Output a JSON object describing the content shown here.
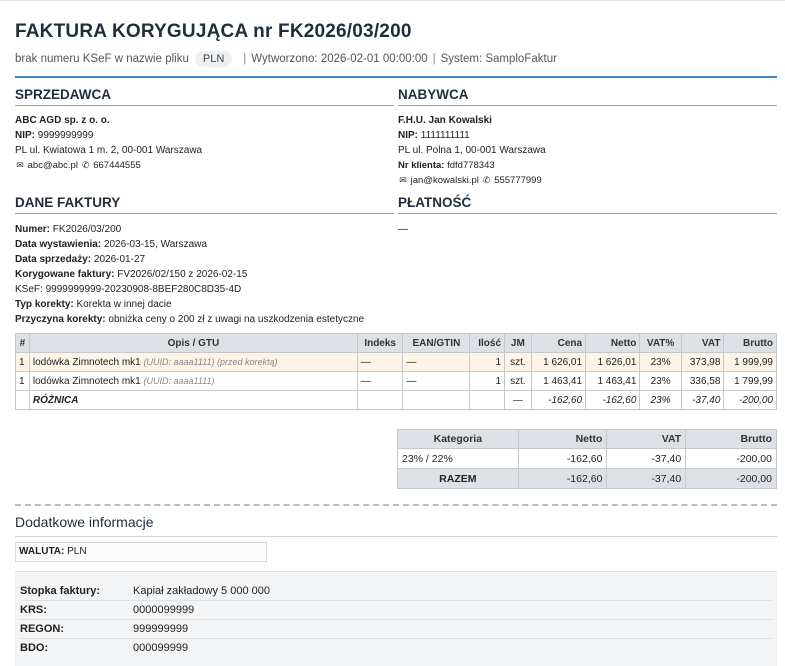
{
  "header": {
    "title": "FAKTURA KORYGUJĄCA nr FK2026/03/200",
    "ksef_note": "brak numeru KSeF w nazwie pliku",
    "currency_pill": "PLN",
    "created": "Wytworzono: 2026-02-01 00:00:00",
    "system": "System: SamploFaktur",
    "separator": "|"
  },
  "seller": {
    "heading": "SPRZEDAWCA",
    "name": "ABC AGD sp. z o. o.",
    "nip_label": "NIP:",
    "nip": "9999999999",
    "address": "PL ul. Kwiatowa 1 m. 2, 00-001 Warszawa",
    "email": "abc@abc.pl",
    "phone": "667444555"
  },
  "buyer": {
    "heading": "NABYWCA",
    "name": "F.H.U. Jan Kowalski",
    "nip_label": "NIP:",
    "nip": "1111111111",
    "address": "PL ul. Polna 1, 00-001 Warszawa",
    "client_label": "Nr klienta:",
    "client_no": "fdfd778343",
    "email": "jan@kowalski.pl",
    "phone": "555777999"
  },
  "invoice": {
    "heading": "DANE FAKTURY",
    "number_label": "Numer:",
    "number": "FK2026/03/200",
    "issue_label": "Data wystawienia:",
    "issue": "2026-03-15, Warszawa",
    "sale_label": "Data sprzedaży:",
    "sale": "2026-01-27",
    "corrected_label": "Korygowane faktury:",
    "corrected": "FV2026/02/150 z 2026-02-15",
    "ksef": "KSeF: 9999999999-20230908-8BEF280C8D35-4D",
    "type_label": "Typ korekty:",
    "type": "Korekta w innej dacie",
    "reason_label": "Przyczyna korekty:",
    "reason": "obniżka ceny o 200 zł z uwagi na uszkodzenia estetyczne"
  },
  "payment": {
    "heading": "PŁATNOŚĆ",
    "value": "—"
  },
  "items": {
    "headers": [
      "#",
      "Opis / GTU",
      "Indeks",
      "EAN/GTIN",
      "Ilość",
      "JM",
      "Cena",
      "Netto",
      "VAT%",
      "VAT",
      "Brutto"
    ],
    "rows": [
      {
        "no": "1",
        "desc": "lodówka Zimnotech mk1",
        "note": "(UUID: aaaa1111) (przed korektą)",
        "index": "—",
        "ean": "—",
        "qty": "1",
        "unit": "szt.",
        "price": "1 626,01",
        "net": "1 626,01",
        "vat_rate": "23%",
        "vat": "373,98",
        "gross": "1 999,99"
      },
      {
        "no": "1",
        "desc": "lodówka Zimnotech mk1",
        "note": "(UUID: aaaa1111)",
        "index": "—",
        "ean": "—",
        "qty": "1",
        "unit": "szt.",
        "price": "1 463,41",
        "net": "1 463,41",
        "vat_rate": "23%",
        "vat": "336,58",
        "gross": "1 799,99"
      }
    ],
    "diff": {
      "label": "RÓŻNICA",
      "unit": "—",
      "price": "-162,60",
      "net": "-162,60",
      "vat_rate": "23%",
      "vat": "-37,40",
      "gross": "-200,00"
    }
  },
  "summary": {
    "headers": [
      "Kategoria",
      "Netto",
      "VAT",
      "Brutto"
    ],
    "row": {
      "category": "23% / 22%",
      "net": "-162,60",
      "vat": "-37,40",
      "gross": "-200,00"
    },
    "total": {
      "label": "RAZEM",
      "net": "-162,60",
      "vat": "-37,40",
      "gross": "-200,00"
    }
  },
  "additional": {
    "heading": "Dodatkowe informacje",
    "currency_label": "WALUTA:",
    "currency": "PLN"
  },
  "footer": {
    "rows": [
      {
        "label": "Stopka faktury:",
        "value": "Kapiał zakładowy 5 000 000"
      },
      {
        "label": "KRS:",
        "value": "0000099999"
      },
      {
        "label": "REGON:",
        "value": "999999999"
      },
      {
        "label": "BDO:",
        "value": "000099999"
      }
    ]
  },
  "icons": [
    "envelope-icon",
    "phone-icon"
  ],
  "colors": {
    "accent": "#3d86c6",
    "before_row": "#fdf3e6",
    "header_bg": "#dde1e5"
  }
}
